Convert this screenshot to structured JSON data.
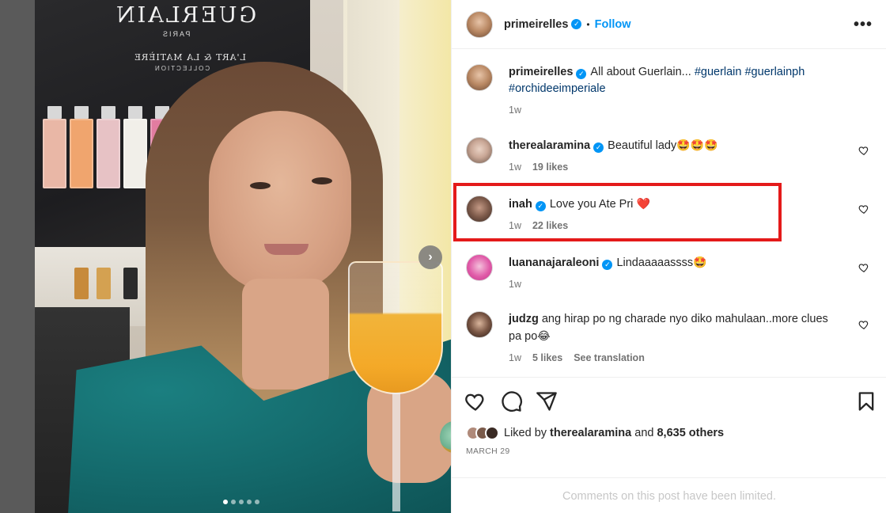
{
  "post_image": {
    "brand_text": "GUERLAIN",
    "brand_sub": "PARIS",
    "collection_text": "L'ART & LA MATIÈRE",
    "collection_sub": "COLLECTION",
    "carousel_total": 5,
    "carousel_active": 1
  },
  "header": {
    "username": "primeirelles",
    "separator": "•",
    "follow_label": "Follow",
    "more_label": "•••"
  },
  "caption": {
    "username": "primeirelles",
    "text": "All about Guerlain...",
    "hashtags": "#guerlain #guerlainph #orchideeimperiale",
    "time": "1w"
  },
  "comments": [
    {
      "username": "therealaramina",
      "text": "Beautiful lady",
      "emoji": "🤩🤩🤩",
      "time": "1w",
      "likes": "19 likes",
      "extra": ""
    },
    {
      "username": "inah",
      "text": "Love you Ate Pri",
      "emoji": "❤️",
      "time": "1w",
      "likes": "22 likes",
      "extra": ""
    },
    {
      "username": "luananajaraleoni",
      "text": "Lindaaaaassss",
      "emoji": "🤩",
      "time": "1w",
      "likes": "",
      "extra": ""
    },
    {
      "username": "judzg",
      "text": "ang hirap po ng charade nyo diko mahulaan..more clues pa po",
      "emoji": "😂",
      "time": "1w",
      "likes": "5 likes",
      "extra": "See translation"
    }
  ],
  "likes": {
    "prefix": "Liked by",
    "user": "therealaramina",
    "middle": "and",
    "others": "8,635 others"
  },
  "date": "MARCH 29",
  "limited_text": "Comments on this post have been limited.",
  "colors": {
    "accent": "#0095f6",
    "highlight": "#e41a1a",
    "hashtag": "#00376b"
  }
}
